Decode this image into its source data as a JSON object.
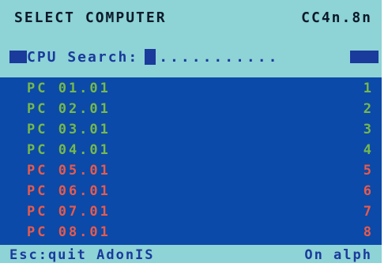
{
  "header": {
    "title": "SELECT COMPUTER",
    "version": "CC4n.8n"
  },
  "search": {
    "label": "CPU Search:",
    "placeholder_dots": "..........."
  },
  "list": {
    "items": [
      {
        "name": "PC 01.01",
        "number": "1",
        "status": "online"
      },
      {
        "name": "PC 02.01",
        "number": "2",
        "status": "online"
      },
      {
        "name": "PC 03.01",
        "number": "3",
        "status": "online"
      },
      {
        "name": "PC 04.01",
        "number": "4",
        "status": "online"
      },
      {
        "name": "PC 05.01",
        "number": "5",
        "status": "offline"
      },
      {
        "name": "PC 06.01",
        "number": "6",
        "status": "offline"
      },
      {
        "name": "PC 07.01",
        "number": "7",
        "status": "offline"
      },
      {
        "name": "PC 08.01",
        "number": "8",
        "status": "offline"
      }
    ]
  },
  "footer": {
    "left": "Esc:quit AdonIS",
    "right": "On alph"
  },
  "colors": {
    "background": "#8ed3d6",
    "list_background": "#0b4aa8",
    "online": "#76b94a",
    "offline": "#e85a4c",
    "text_dark": "#0a1a2a",
    "text_blue": "#1a3a9c"
  }
}
